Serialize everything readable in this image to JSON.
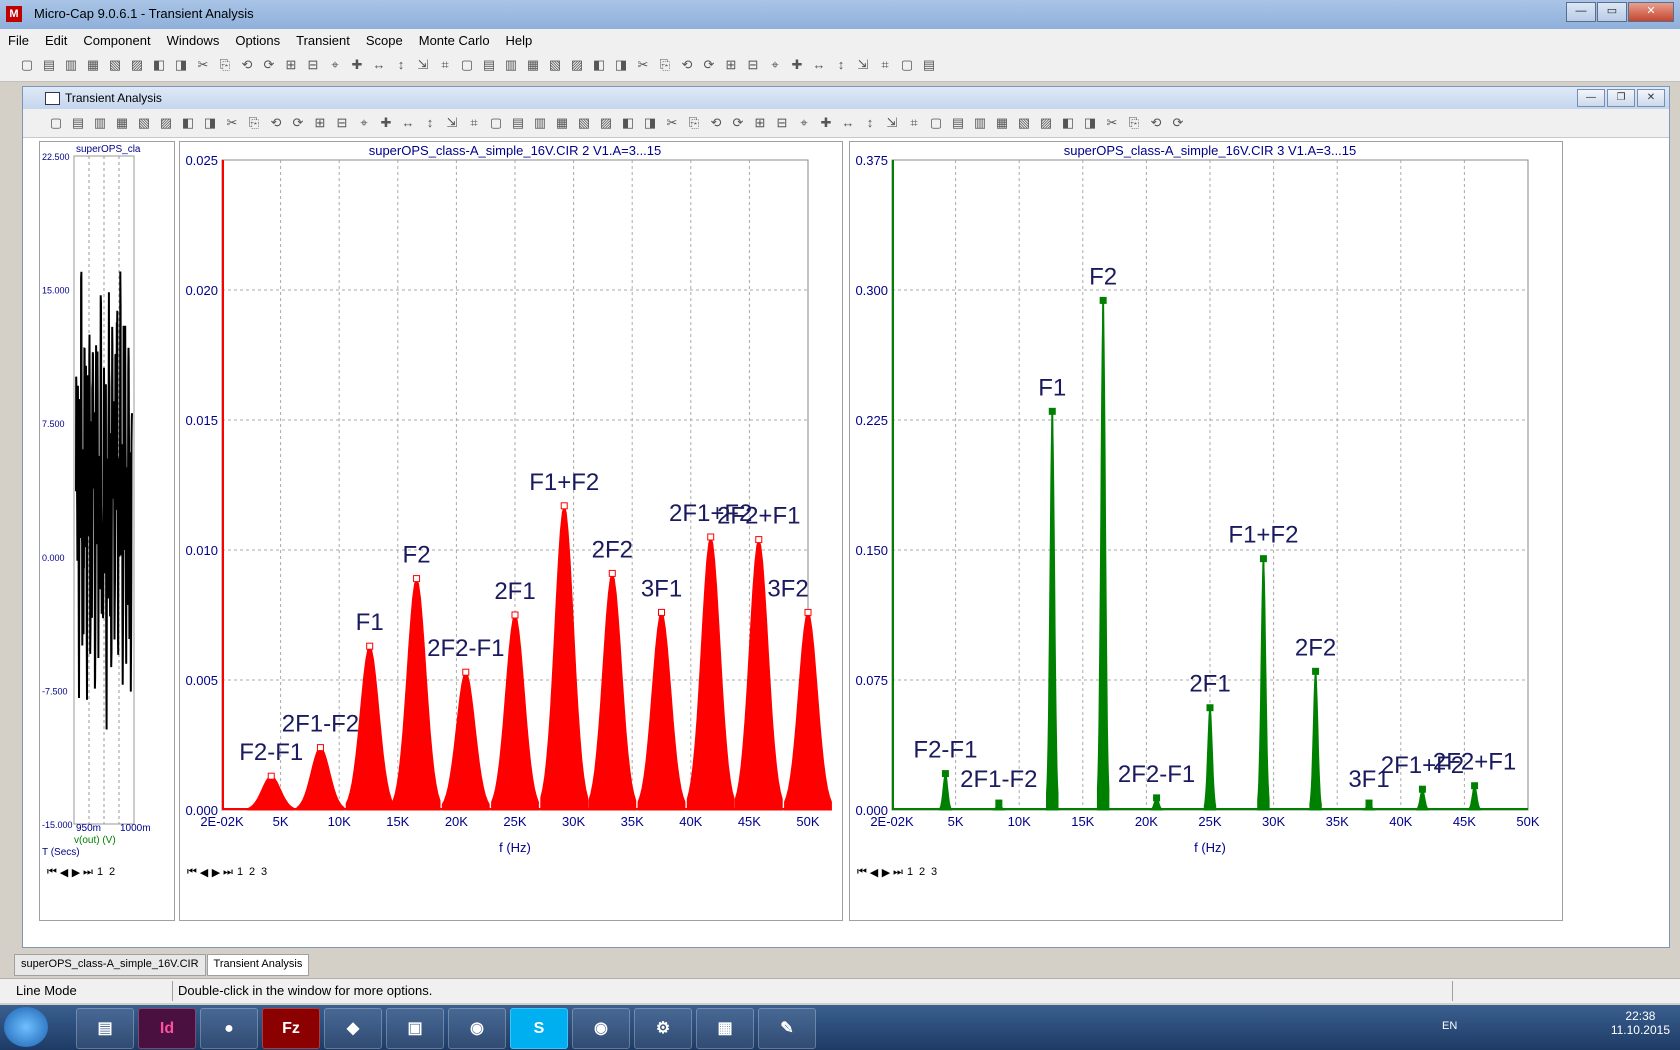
{
  "app_title": "Micro-Cap 9.0.6.1 - Transient Analysis",
  "menu": [
    "File",
    "Edit",
    "Component",
    "Windows",
    "Options",
    "Transient",
    "Scope",
    "Monte Carlo",
    "Help"
  ],
  "child_title": "Transient Analysis",
  "left_plot": {
    "title": "superOPS_cla",
    "y_ticks": [
      "22.500",
      "15.000",
      "7.500",
      "0.000",
      "-7.500",
      "-15.000"
    ],
    "x_ticks": [
      "950m",
      "1000m"
    ],
    "trace_label": "v(out) (V)",
    "x_axis_label": "T (Secs)",
    "tabs": [
      "1",
      "2"
    ]
  },
  "chart_data": [
    {
      "type": "bar",
      "title": "superOPS_class-A_simple_16V.CIR 2 V1.A=3...15",
      "xlabel": "f (Hz)",
      "ylabel": "",
      "x_ticks": [
        "2E-02K",
        "5K",
        "10K",
        "15K",
        "20K",
        "25K",
        "30K",
        "35K",
        "40K",
        "45K",
        "50K"
      ],
      "y_ticks": [
        "0.000",
        "0.005",
        "0.010",
        "0.015",
        "0.020",
        "0.025"
      ],
      "xlim": [
        0,
        50000
      ],
      "ylim": [
        0,
        0.025
      ],
      "grid": true,
      "color": "#ff0000",
      "peaks": [
        {
          "label": "F2-F1",
          "x": 4200,
          "y": 0.0013
        },
        {
          "label": "2F1-F2",
          "x": 8400,
          "y": 0.0024
        },
        {
          "label": "F1",
          "x": 12600,
          "y": 0.0063
        },
        {
          "label": "F2",
          "x": 16600,
          "y": 0.0089
        },
        {
          "label": "2F2-F1",
          "x": 20800,
          "y": 0.0053
        },
        {
          "label": "2F1",
          "x": 25000,
          "y": 0.0075
        },
        {
          "label": "F1+F2",
          "x": 29200,
          "y": 0.0117
        },
        {
          "label": "2F2",
          "x": 33300,
          "y": 0.0091
        },
        {
          "label": "3F1",
          "x": 37500,
          "y": 0.0076
        },
        {
          "label": "2F1+F2",
          "x": 41700,
          "y": 0.0105
        },
        {
          "label": "2F2+F1",
          "x": 45800,
          "y": 0.0104
        },
        {
          "label": "3F2",
          "x": 50000,
          "y": 0.0076
        }
      ],
      "tabs": [
        "1",
        "2",
        "3"
      ]
    },
    {
      "type": "bar",
      "title": "superOPS_class-A_simple_16V.CIR 3 V1.A=3...15",
      "xlabel": "f (Hz)",
      "ylabel": "",
      "x_ticks": [
        "2E-02K",
        "5K",
        "10K",
        "15K",
        "20K",
        "25K",
        "30K",
        "35K",
        "40K",
        "45K",
        "50K"
      ],
      "y_ticks": [
        "0.000",
        "0.075",
        "0.150",
        "0.225",
        "0.300",
        "0.375"
      ],
      "xlim": [
        0,
        50000
      ],
      "ylim": [
        0,
        0.375
      ],
      "grid": true,
      "color": "#008000",
      "peaks": [
        {
          "label": "F2-F1",
          "x": 4200,
          "y": 0.021
        },
        {
          "label": "2F1-F2",
          "x": 8400,
          "y": 0.004
        },
        {
          "label": "F1",
          "x": 12600,
          "y": 0.23
        },
        {
          "label": "F2",
          "x": 16600,
          "y": 0.294
        },
        {
          "label": "2F2-F1",
          "x": 20800,
          "y": 0.007
        },
        {
          "label": "2F1",
          "x": 25000,
          "y": 0.059
        },
        {
          "label": "F1+F2",
          "x": 29200,
          "y": 0.145
        },
        {
          "label": "2F2",
          "x": 33300,
          "y": 0.08
        },
        {
          "label": "3F1",
          "x": 37500,
          "y": 0.004
        },
        {
          "label": "2F1+F2",
          "x": 41700,
          "y": 0.012
        },
        {
          "label": "2F2+F1",
          "x": 45800,
          "y": 0.014
        }
      ],
      "tabs": [
        "1",
        "2",
        "3"
      ]
    }
  ],
  "doc_tabs": [
    "superOPS_class-A_simple_16V.CIR",
    "Transient Analysis"
  ],
  "status": {
    "mode": "Line Mode",
    "hint": "Double-click in the window for more options."
  },
  "taskbar": {
    "apps": [
      "Id",
      "Fz",
      "S"
    ],
    "lang": "EN",
    "time": "22:38",
    "date": "11.10.2015"
  },
  "colors": {
    "red_trace": "#ff0000",
    "green_trace": "#008000",
    "axis_text": "#00008b",
    "label_text": "#1a1a5e"
  }
}
